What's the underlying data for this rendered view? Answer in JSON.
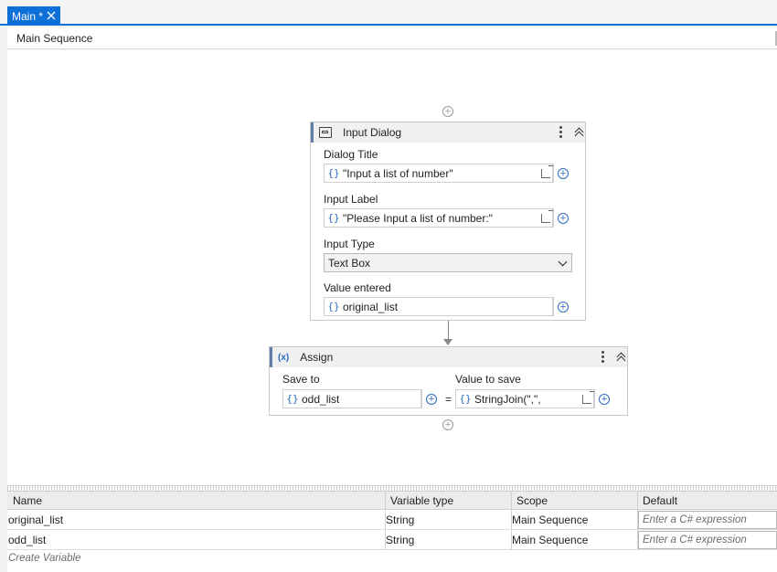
{
  "tab": {
    "label": "Main *"
  },
  "breadcrumb": "Main Sequence",
  "input_dialog": {
    "title": "Input Dialog",
    "dialog_title_label": "Dialog Title",
    "dialog_title_value": "\"Input a list of number\"",
    "input_label_label": "Input Label",
    "input_label_value": "\"Please Input a list of number:\"",
    "input_type_label": "Input Type",
    "input_type_value": "Text Box",
    "value_entered_label": "Value entered",
    "value_entered_value": "original_list",
    "brace": "{}"
  },
  "assign": {
    "icon_text": "(x)",
    "title": "Assign",
    "save_to_label": "Save to",
    "save_to_value": "odd_list",
    "value_to_save_label": "Value to save",
    "value_to_save_value": "StringJoin(\",\",",
    "equals": "="
  },
  "variables": {
    "columns": [
      "Name",
      "Variable type",
      "Scope",
      "Default"
    ],
    "rows": [
      {
        "name": "original_list",
        "type": "String",
        "scope": "Main Sequence",
        "default_placeholder": "Enter a C# expression"
      },
      {
        "name": "odd_list",
        "type": "String",
        "scope": "Main Sequence",
        "default_placeholder": "Enter a C# expression"
      }
    ],
    "create_label": "Create Variable"
  },
  "colors": {
    "accent": "#0e6fd6",
    "expression_brace": "#2a6bc2"
  }
}
